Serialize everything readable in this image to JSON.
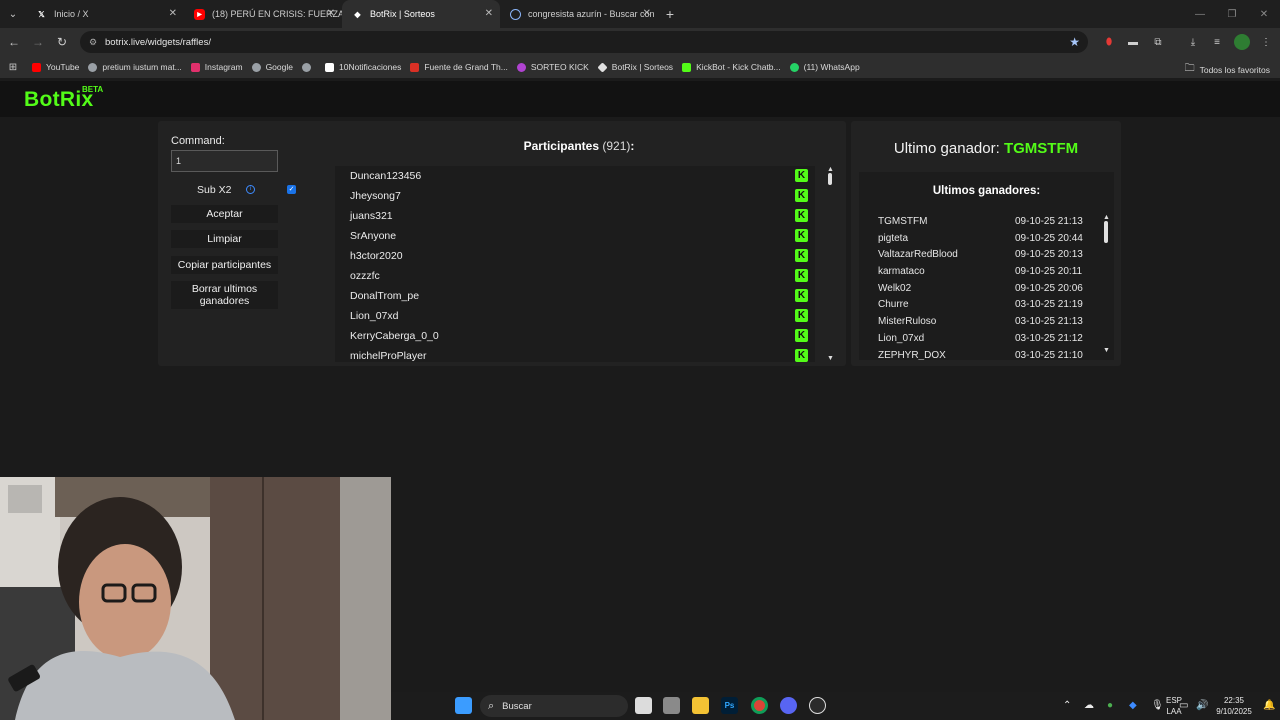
{
  "browser": {
    "tabs": [
      {
        "title": "Inicio / X",
        "icon": "x-logo-icon",
        "active": false
      },
      {
        "title": "(18) PERÚ EN CRISIS: FUERZA P",
        "icon": "youtube-icon",
        "active": false
      },
      {
        "title": "BotRix | Sorteos",
        "icon": "botrix-icon",
        "active": true
      },
      {
        "title": "congresista azurín - Buscar con",
        "icon": "google-icon",
        "active": false
      }
    ],
    "url": "botrix.live/widgets/raffles/",
    "bookmarks": [
      {
        "label": "YouTube",
        "color": "#ff0000"
      },
      {
        "label": "pretium iustum mat...",
        "color": "#9aa0a6"
      },
      {
        "label": "Instagram",
        "color": "#e1306c"
      },
      {
        "label": "Google",
        "color": "#9aa0a6"
      },
      {
        "label": "",
        "color": "#9aa0a6"
      },
      {
        "label": "10Notificaciones",
        "color": "#ffffff"
      },
      {
        "label": "Fuente de Grand Th...",
        "color": "#d93025"
      },
      {
        "label": "SORTEO KICK",
        "color": "#b043d1"
      },
      {
        "label": "BotRix | Sorteos",
        "color": "#e0e0e0"
      },
      {
        "label": "KickBot - Kick Chatb...",
        "color": "#53fc18"
      },
      {
        "label": "(11) WhatsApp",
        "color": "#25d366"
      }
    ],
    "bookmarks_folder": "Todos los favoritos"
  },
  "app": {
    "logo": "BotRix",
    "beta": "BETA",
    "accent": "#53fc18"
  },
  "controls": {
    "command_label": "Command:",
    "command_value": "1",
    "sub_label": "Sub X2",
    "sub_checked": true,
    "accept": "Aceptar",
    "clear": "Limpiar",
    "copy": "Copiar participantes",
    "delete_line1": "Borrar ultimos",
    "delete_line2": "ganadores"
  },
  "participants": {
    "title": "Participantes",
    "count": "(921)",
    "colon": ":",
    "list": [
      "Duncan123456",
      "Jheysong7",
      "juans321",
      "SrAnyone",
      "h3ctor2020",
      "ozzzfc",
      "DonalTrom_pe",
      "Lion_07xd",
      "KerryCaberga_0_0",
      "michelProPlayer"
    ]
  },
  "winner": {
    "label": "Ultimo ganador: ",
    "name": "TGMSTFM"
  },
  "recent": {
    "title": "Ultimos ganadores:",
    "list": [
      {
        "name": "TGMSTFM",
        "date": "09-10-25 21:13"
      },
      {
        "name": "pigteta",
        "date": "09-10-25 20:44"
      },
      {
        "name": "ValtazarRedBlood",
        "date": "09-10-25 20:13"
      },
      {
        "name": "karmataco",
        "date": "09-10-25 20:11"
      },
      {
        "name": "Welk02",
        "date": "09-10-25 20:06"
      },
      {
        "name": "Churre",
        "date": "03-10-25 21:19"
      },
      {
        "name": "MisterRuloso",
        "date": "03-10-25 21:13"
      },
      {
        "name": "Lion_07xd",
        "date": "03-10-25 21:12"
      },
      {
        "name": "ZEPHYR_DOX",
        "date": "03-10-25 21:10"
      }
    ]
  },
  "taskbar": {
    "search": "Buscar",
    "lang1": "ESP",
    "lang2": "LAA",
    "time": "22:35",
    "date": "9/10/2025"
  }
}
